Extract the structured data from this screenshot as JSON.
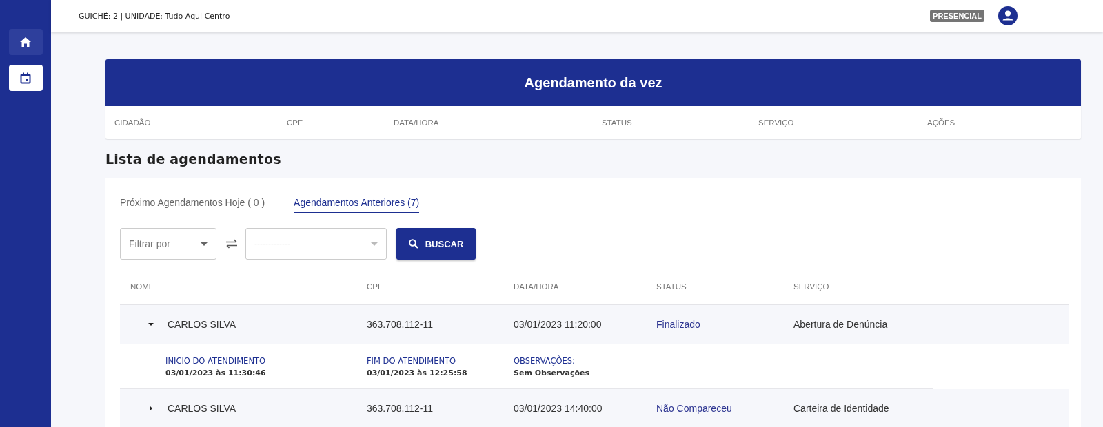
{
  "sidebar": {
    "items": [
      {
        "kind": "home",
        "selected": false
      },
      {
        "kind": "calendar",
        "selected": true
      }
    ]
  },
  "header": {
    "info": "GUICHÊ: 2 | UNIDADE: Tudo Aqui Centro",
    "mode_badge": "PRESENCIAL"
  },
  "current": {
    "title": "Agendamento da vez",
    "columns": [
      "CIDADÃO",
      "CPF",
      "DATA/HORA",
      "STATUS",
      "SERVIÇO",
      "AÇÕES"
    ]
  },
  "list": {
    "title": "Lista de agendamentos",
    "tabs": [
      {
        "label": "Próximo Agendamentos Hoje ( 0 )",
        "selected": false
      },
      {
        "label": "Agendamentos Anteriores (7)",
        "selected": true
      }
    ],
    "filter": {
      "placeholder": "Filtrar por",
      "value_placeholder": "-------------",
      "button": "BUSCAR"
    },
    "columns": [
      "NOME",
      "CPF",
      "DATA/HORA",
      "STATUS",
      "SERVIÇO"
    ],
    "rows": [
      {
        "name": "CARLOS SILVA",
        "cpf": "363.708.112-11",
        "datetime": "03/01/2023 11:20:00",
        "status": "Finalizado",
        "service": "Abertura de Denúncia",
        "expanded": true,
        "details": [
          {
            "label": "INICIO DO ATENDIMENTO",
            "value": "03/01/2023 às 11:30:46"
          },
          {
            "label": "FIM DO ATENDIMENTO",
            "value": "03/01/2023 às 12:25:58"
          },
          {
            "label": "OBSERVAÇÕES:",
            "value": "Sem Observações"
          }
        ]
      },
      {
        "name": "CARLOS SILVA",
        "cpf": "363.708.112-11",
        "datetime": "03/01/2023 14:40:00",
        "status": "Não Compareceu",
        "service": "Carteira de Identidade",
        "expanded": false
      }
    ]
  }
}
